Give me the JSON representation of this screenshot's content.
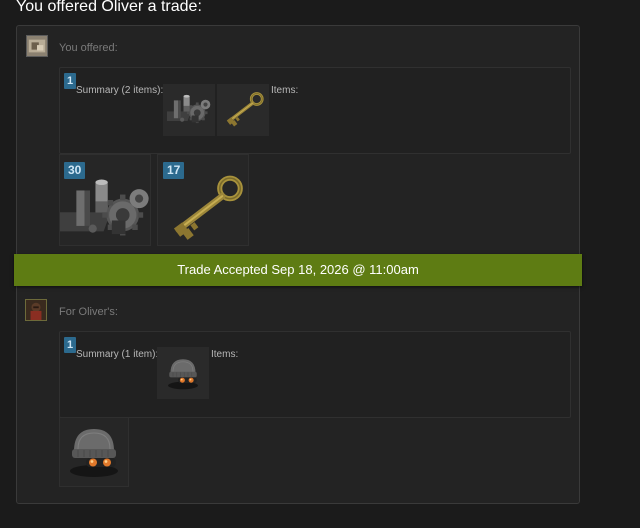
{
  "heading": "You offered Oliver a trade:",
  "offered": {
    "label": "You offered:",
    "summary": {
      "badge": "1",
      "text": "Summary (2 items):",
      "items_label": "Items:"
    },
    "items": [
      {
        "count": "30",
        "icon": "gears-icon"
      },
      {
        "count": "17",
        "icon": "key-icon"
      }
    ]
  },
  "banner": "Trade Accepted Sep 18, 2026 @ 11:00am",
  "for": {
    "label": "For Oliver's:",
    "summary": {
      "badge": "1",
      "text": "Summary (1 item):",
      "items_label": "Items:"
    },
    "items": [
      {
        "count": "",
        "icon": "beanie-goggles-hat-icon"
      }
    ]
  },
  "colors": {
    "banner": "#5e7c13",
    "badge": "#2c6a8e",
    "panel": "#232323",
    "background": "#1b1b1b"
  }
}
